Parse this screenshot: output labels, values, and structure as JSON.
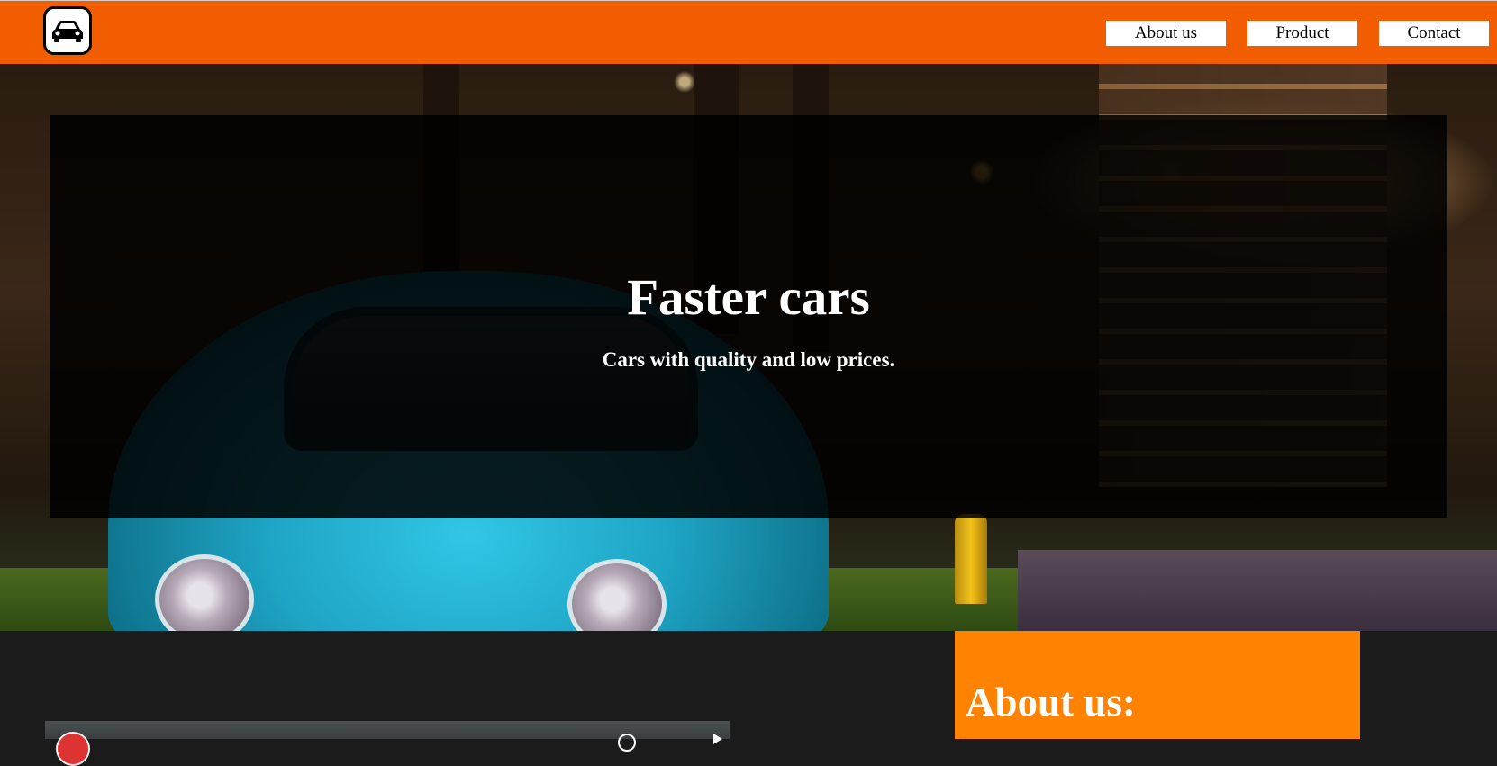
{
  "header": {
    "logo_icon": "car-icon",
    "nav": {
      "about": "About us",
      "product": "Product",
      "contact": "Contact"
    },
    "bar_color": "#f25d00"
  },
  "hero": {
    "title": "Faster cars",
    "subtitle": "Cars with quality and low prices."
  },
  "about": {
    "title": "About us:",
    "box_color": "#ff8200"
  }
}
